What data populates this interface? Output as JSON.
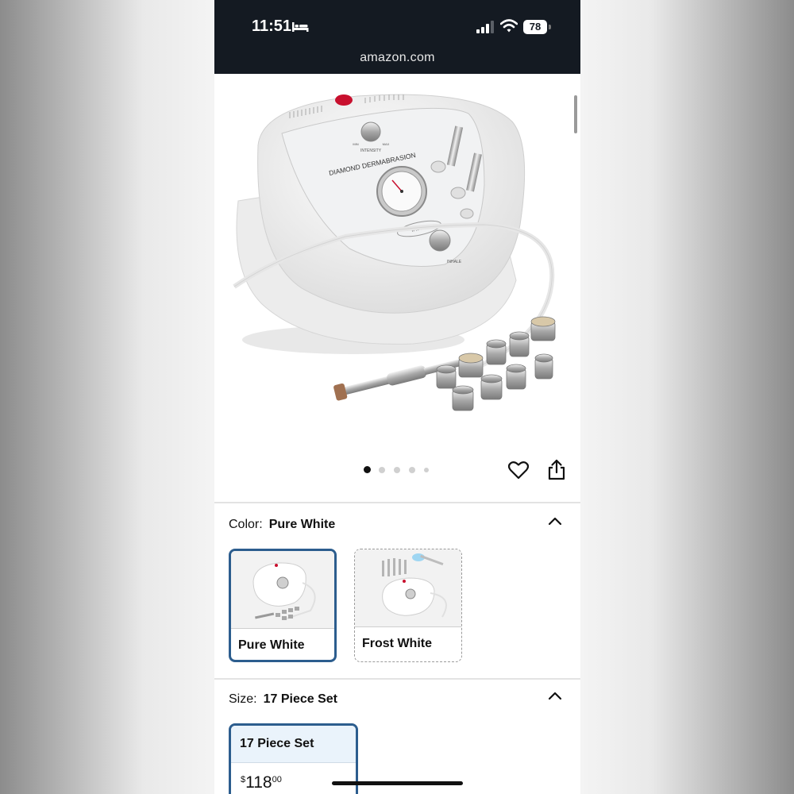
{
  "status_bar": {
    "time": "11:51",
    "battery": "78",
    "icons": [
      "bed-icon",
      "signal-icon",
      "wifi-icon",
      "battery-icon"
    ]
  },
  "browser": {
    "url": "amazon.com"
  },
  "product_image": {
    "labels": {
      "brand_plate": "DIAMOND DERMABRASION",
      "knob_label": "INTENSITY",
      "knob_min": "MIN",
      "knob_max": "MAX",
      "vacuum_label": "VACUUM",
      "button_label": "INHALE"
    },
    "carousel": {
      "count": 5,
      "active_index": 0
    },
    "icons": [
      "heart-icon",
      "share-icon"
    ]
  },
  "color_option": {
    "label": "Color:",
    "selected": "Pure White",
    "swatches": [
      {
        "name": "Pure White",
        "selected": true
      },
      {
        "name": "Frost White",
        "selected": false
      }
    ]
  },
  "size_option": {
    "label": "Size:",
    "selected": "17 Piece Set",
    "cards": [
      {
        "name": "17 Piece Set",
        "price_symbol": "$",
        "price_whole": "118",
        "price_fraction": "00",
        "selected": true
      }
    ]
  },
  "colors": {
    "status_bar_bg": "#141a22",
    "selected_border": "#2c5d8e",
    "size_card_header": "#eaf3fb"
  }
}
